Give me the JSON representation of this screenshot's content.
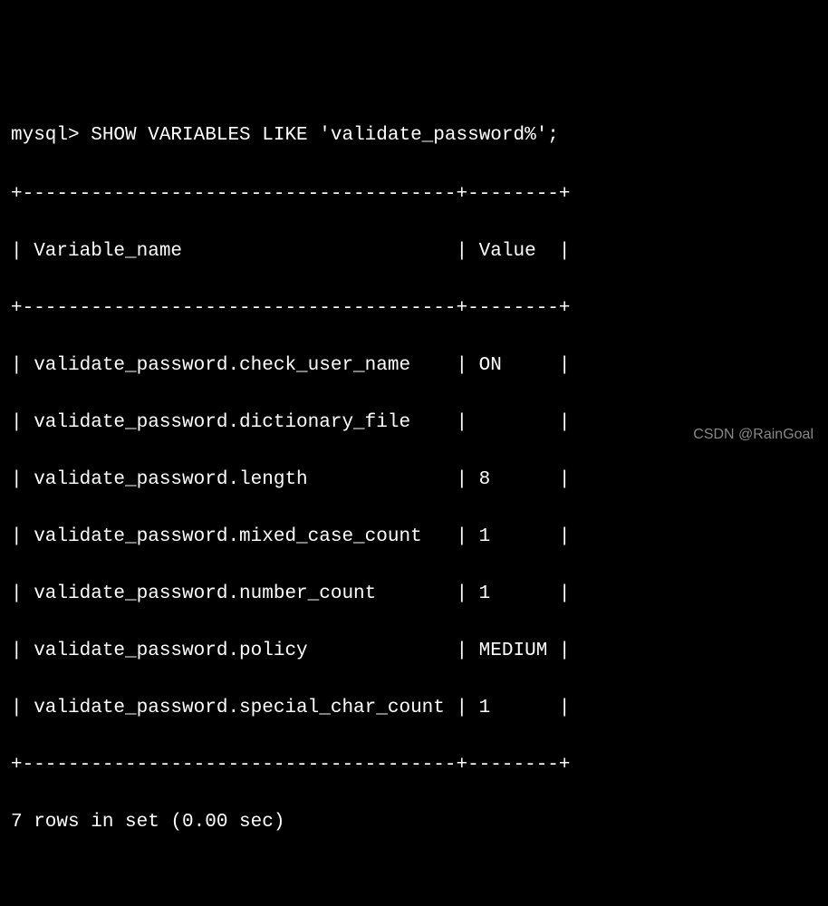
{
  "prompt": "mysql> ",
  "command": "SHOW VARIABLES LIKE 'validate_password%';",
  "headers": {
    "col1": "Variable_name",
    "col2": "Value"
  },
  "rows": [
    {
      "name": "validate_password.check_user_name",
      "value": "ON"
    },
    {
      "name": "validate_password.dictionary_file",
      "value": ""
    },
    {
      "name": "validate_password.length",
      "value": "8"
    },
    {
      "name": "validate_password.mixed_case_count",
      "value": "1"
    },
    {
      "name": "validate_password.number_count",
      "value": "1"
    },
    {
      "name": "validate_password.policy",
      "value": "MEDIUM"
    },
    {
      "name": "validate_password.special_char_count",
      "value": "1"
    }
  ],
  "summary": "7 rows in set (0.00 sec)",
  "watermark": "CSDN @RainGoal",
  "border_top": "+--------------------------------------+--------+",
  "header_row": "| Variable_name                        | Value  |",
  "border_mid": "+--------------------------------------+--------+",
  "data_rows": [
    "| validate_password.check_user_name    | ON     |",
    "| validate_password.dictionary_file    |        |",
    "| validate_password.length             | 8      |",
    "| validate_password.mixed_case_count   | 1      |",
    "| validate_password.number_count       | 1      |",
    "| validate_password.policy             | MEDIUM |",
    "| validate_password.special_char_count | 1      |"
  ],
  "border_bot": "+--------------------------------------+--------+",
  "chart_data": {
    "type": "table",
    "title": "SHOW VARIABLES LIKE 'validate_password%'",
    "columns": [
      "Variable_name",
      "Value"
    ],
    "rows": [
      [
        "validate_password.check_user_name",
        "ON"
      ],
      [
        "validate_password.dictionary_file",
        ""
      ],
      [
        "validate_password.length",
        "8"
      ],
      [
        "validate_password.mixed_case_count",
        "1"
      ],
      [
        "validate_password.number_count",
        "1"
      ],
      [
        "validate_password.policy",
        "MEDIUM"
      ],
      [
        "validate_password.special_char_count",
        "1"
      ]
    ]
  }
}
